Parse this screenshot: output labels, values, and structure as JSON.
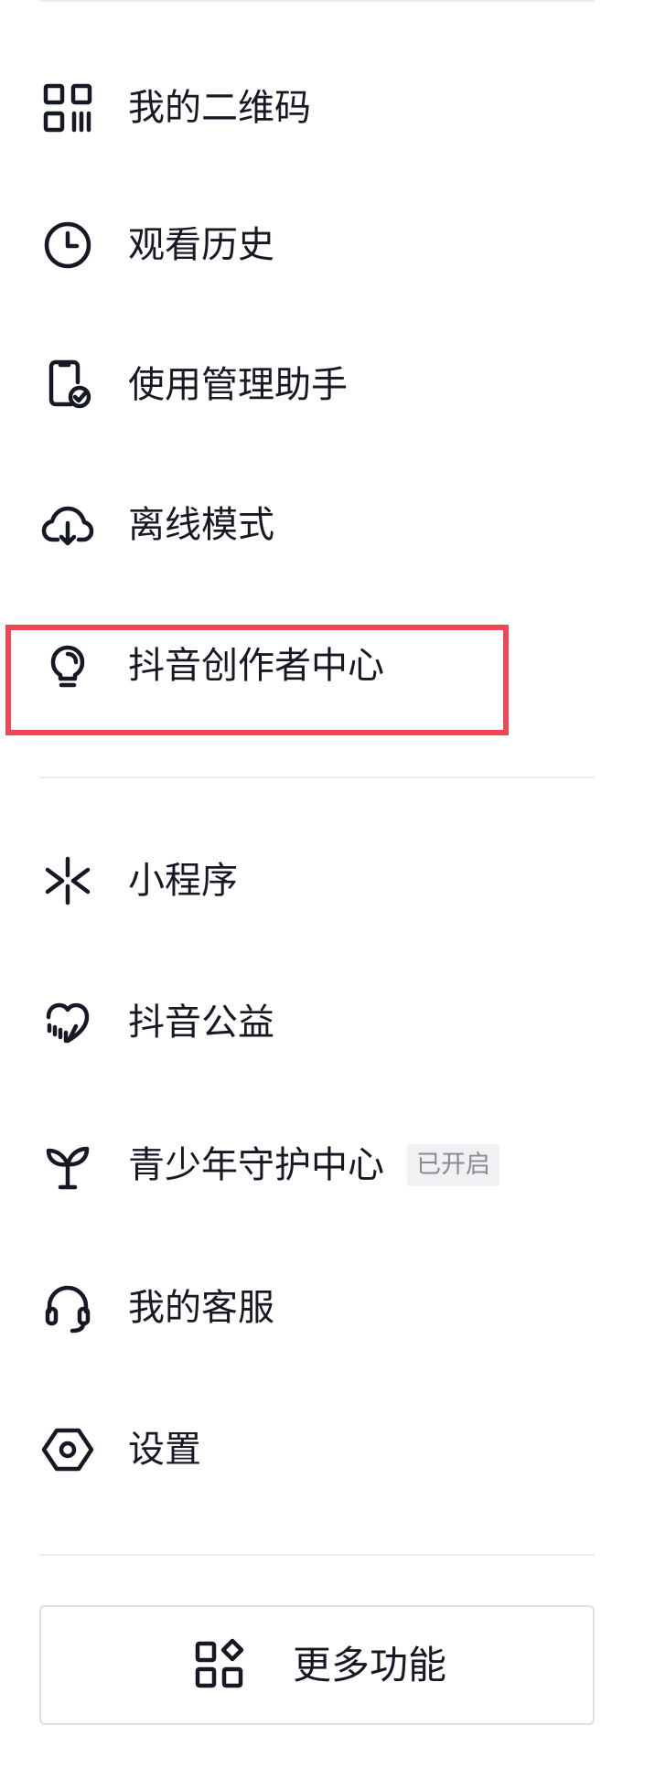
{
  "menu": {
    "items": [
      {
        "label": "我的二维码",
        "icon": "qr-code-icon"
      },
      {
        "label": "观看历史",
        "icon": "clock-icon"
      },
      {
        "label": "使用管理助手",
        "icon": "phone-check-icon"
      },
      {
        "label": "离线模式",
        "icon": "cloud-download-icon"
      },
      {
        "label": "抖音创作者中心",
        "icon": "lightbulb-icon"
      },
      {
        "label": "小程序",
        "icon": "mini-program-icon"
      },
      {
        "label": "抖音公益",
        "icon": "charity-heart-icon"
      },
      {
        "label": "青少年守护中心",
        "icon": "sprout-icon",
        "badge": "已开启"
      },
      {
        "label": "我的客服",
        "icon": "headset-icon"
      },
      {
        "label": "设置",
        "icon": "settings-hexagon-icon"
      }
    ]
  },
  "more_button": {
    "label": "更多功能",
    "icon": "apps-grid-icon"
  },
  "colors": {
    "text": "#161823",
    "divider": "#ececec",
    "highlight": "#ef4753",
    "badge_bg": "#f1f1f3",
    "badge_text": "#8a8b91"
  }
}
